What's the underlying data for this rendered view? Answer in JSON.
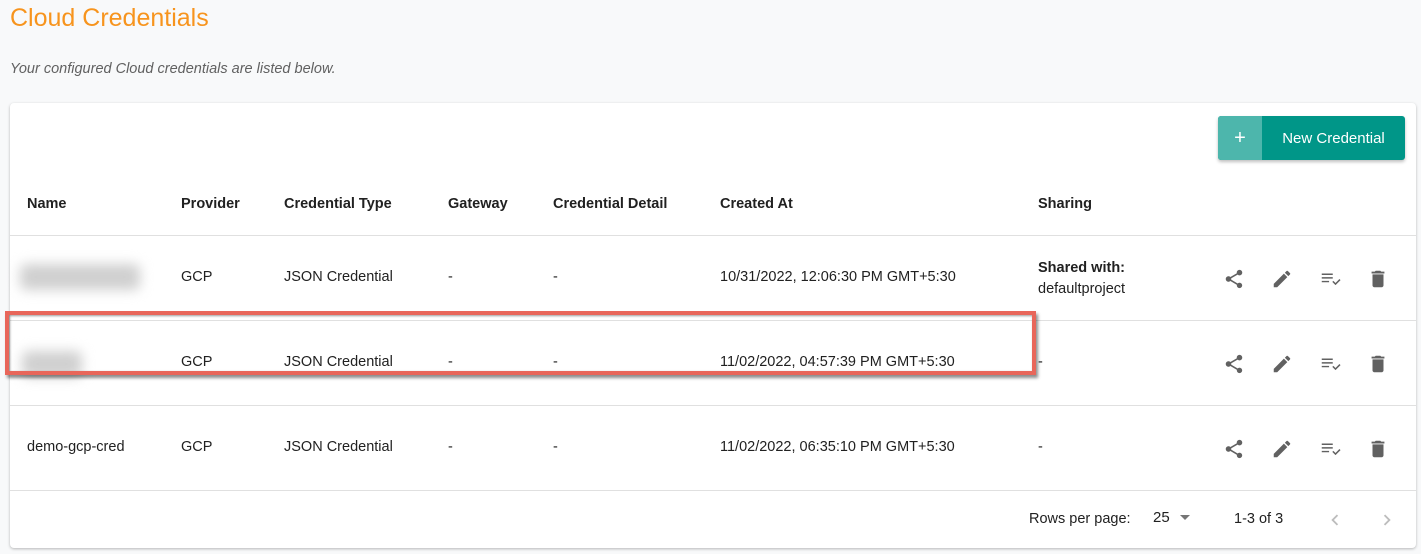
{
  "page": {
    "title": "Cloud Credentials",
    "subtitle": "Your configured Cloud credentials are listed below."
  },
  "toolbar": {
    "new_icon": "+",
    "new_label": "New Credential"
  },
  "table": {
    "columns": [
      "Name",
      "Provider",
      "Credential Type",
      "Gateway",
      "Credential Detail",
      "Created At",
      "Sharing"
    ],
    "rows": [
      {
        "name": "",
        "name_blurred": true,
        "provider": "GCP",
        "type": "JSON Credential",
        "gateway": "-",
        "detail": "-",
        "created": "10/31/2022, 12:06:30 PM GMT+5:30",
        "sharing_label": "Shared with:",
        "sharing_value": "defaultproject"
      },
      {
        "name": "",
        "name_blurred": true,
        "provider": "GCP",
        "type": "JSON Credential",
        "gateway": "-",
        "detail": "-",
        "created": "11/02/2022, 04:57:39 PM GMT+5:30",
        "sharing_label": "",
        "sharing_value": "-"
      },
      {
        "name": "demo-gcp-cred",
        "name_blurred": false,
        "provider": "GCP",
        "type": "JSON Credential",
        "gateway": "-",
        "detail": "-",
        "created": "11/02/2022, 06:35:10 PM GMT+5:30",
        "sharing_label": "",
        "sharing_value": "-",
        "highlighted": true
      }
    ],
    "row_actions": [
      "share-icon",
      "edit-icon",
      "checklist-icon",
      "delete-icon"
    ]
  },
  "pagination": {
    "rows_per_page_label": "Rows per page:",
    "rows_per_page": "25",
    "range": "1-3 of 3"
  },
  "colors": {
    "title": "#f7941d",
    "primary": "#009688",
    "highlight": "#e8665a"
  }
}
